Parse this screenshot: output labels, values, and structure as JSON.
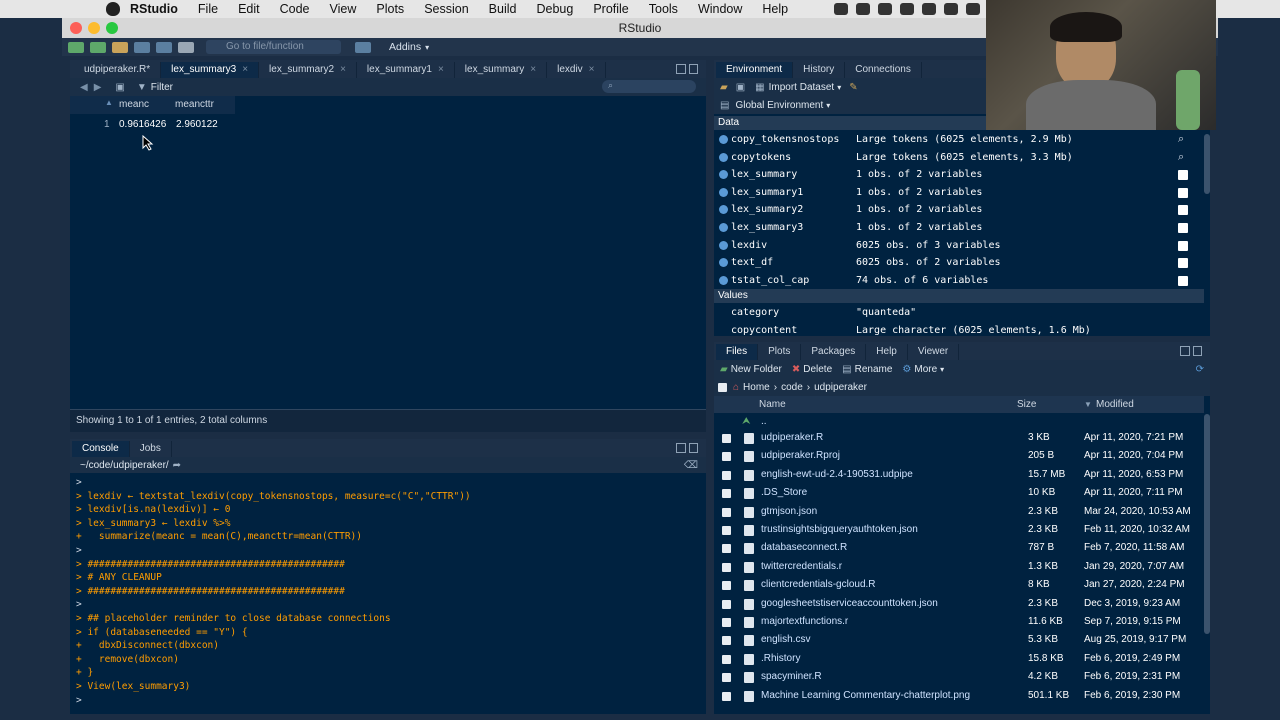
{
  "menubar": {
    "app": "RStudio",
    "items": [
      "File",
      "Edit",
      "Code",
      "View",
      "Plots",
      "Session",
      "Build",
      "Debug",
      "Profile",
      "Tools",
      "Window",
      "Help"
    ]
  },
  "window": {
    "title": "RStudio"
  },
  "toolbar": {
    "goto_placeholder": "Go to file/function",
    "addins": "Addins"
  },
  "editor": {
    "tabs": [
      {
        "label": "udpiperaker.R*"
      },
      {
        "label": "lex_summary3"
      },
      {
        "label": "lex_summary2"
      },
      {
        "label": "lex_summary1"
      },
      {
        "label": "lex_summary"
      },
      {
        "label": "lexdiv"
      }
    ],
    "filter_label": "Filter",
    "columns": [
      "meanc",
      "meancttr"
    ],
    "rows": [
      {
        "index": "1",
        "meanc": "0.9616426",
        "meancttr": "2.960122"
      }
    ],
    "footer": "Showing 1 to 1 of 1 entries, 2 total columns"
  },
  "console": {
    "tabs": [
      "Console",
      "Jobs"
    ],
    "path": "~/code/udpiperaker/",
    "lines": [
      {
        "t": ">",
        "kind": "prompt"
      },
      {
        "t": "> lexdiv ← textstat_lexdiv(copy_tokensnostops, measure=c(\"C\",\"CTTR\"))",
        "kind": "code"
      },
      {
        "t": "> lexdiv[is.na(lexdiv)] ← 0",
        "kind": "code"
      },
      {
        "t": "> lex_summary3 ← lexdiv %>%",
        "kind": "code"
      },
      {
        "t": "+   summarize(meanc = mean(C),meancttr=mean(CTTR))",
        "kind": "code"
      },
      {
        "t": ">",
        "kind": "prompt"
      },
      {
        "t": "> #############################################",
        "kind": "code"
      },
      {
        "t": "> # ANY CLEANUP",
        "kind": "code"
      },
      {
        "t": "> #############################################",
        "kind": "code"
      },
      {
        "t": ">",
        "kind": "prompt"
      },
      {
        "t": "> ## placeholder reminder to close database connections",
        "kind": "code"
      },
      {
        "t": "> if (databaseneeded == \"Y\") {",
        "kind": "code"
      },
      {
        "t": "+   dbxDisconnect(dbxcon)",
        "kind": "code"
      },
      {
        "t": "+   remove(dbxcon)",
        "kind": "code"
      },
      {
        "t": "+ }",
        "kind": "code"
      },
      {
        "t": "> View(lex_summary3)",
        "kind": "code"
      },
      {
        "t": ">",
        "kind": "prompt"
      }
    ]
  },
  "environment": {
    "tabs": [
      "Environment",
      "History",
      "Connections"
    ],
    "import_label": "Import Dataset",
    "scope": "Global Environment",
    "data_header": "Data",
    "values_header": "Values",
    "data": [
      {
        "name": "copy_tokensnostops",
        "value": "Large tokens (6025 elements, 2.9 Mb)",
        "icon": "search-icon"
      },
      {
        "name": "copytokens",
        "value": "Large tokens (6025 elements, 3.3 Mb)",
        "icon": "search-icon"
      },
      {
        "name": "lex_summary",
        "value": "1 obs. of 2 variables",
        "icon": "table-icon"
      },
      {
        "name": "lex_summary1",
        "value": "1 obs. of 2 variables",
        "icon": "table-icon"
      },
      {
        "name": "lex_summary2",
        "value": "1 obs. of 2 variables",
        "icon": "table-icon"
      },
      {
        "name": "lex_summary3",
        "value": "1 obs. of 2 variables",
        "icon": "table-icon"
      },
      {
        "name": "lexdiv",
        "value": "6025 obs. of 3 variables",
        "icon": "table-icon"
      },
      {
        "name": "text_df",
        "value": "6025 obs. of 2 variables",
        "icon": "table-icon"
      },
      {
        "name": "tstat_col_cap",
        "value": "74 obs. of 6 variables",
        "icon": "table-icon"
      }
    ],
    "values": [
      {
        "name": "category",
        "value": "\"quanteda\""
      },
      {
        "name": "copycontent",
        "value": "Large character (6025 elements, 1.6 Mb)"
      }
    ]
  },
  "files": {
    "tabs": [
      "Files",
      "Plots",
      "Packages",
      "Help",
      "Viewer"
    ],
    "actions": {
      "new_folder": "New Folder",
      "delete": "Delete",
      "rename": "Rename",
      "more": "More"
    },
    "breadcrumb": [
      "Home",
      "code",
      "udpiperaker"
    ],
    "columns": {
      "name": "Name",
      "size": "Size",
      "modified": "Modified"
    },
    "up": "..",
    "rows": [
      {
        "name": "udpiperaker.R",
        "size": "3 KB",
        "modified": "Apr 11, 2020, 7:21 PM"
      },
      {
        "name": "udpiperaker.Rproj",
        "size": "205 B",
        "modified": "Apr 11, 2020, 7:04 PM"
      },
      {
        "name": "english-ewt-ud-2.4-190531.udpipe",
        "size": "15.7 MB",
        "modified": "Apr 11, 2020, 6:53 PM"
      },
      {
        "name": ".DS_Store",
        "size": "10 KB",
        "modified": "Apr 11, 2020, 7:11 PM"
      },
      {
        "name": "gtmjson.json",
        "size": "2.3 KB",
        "modified": "Mar 24, 2020, 10:53 AM"
      },
      {
        "name": "trustinsightsbigqueryauthtoken.json",
        "size": "2.3 KB",
        "modified": "Feb 11, 2020, 10:32 AM"
      },
      {
        "name": "databaseconnect.R",
        "size": "787 B",
        "modified": "Feb 7, 2020, 11:58 AM"
      },
      {
        "name": "twittercredentials.r",
        "size": "1.3 KB",
        "modified": "Jan 29, 2020, 7:07 AM"
      },
      {
        "name": "clientcredentials-gcloud.R",
        "size": "8 KB",
        "modified": "Jan 27, 2020, 2:24 PM"
      },
      {
        "name": "googlesheetstiserviceaccounttoken.json",
        "size": "2.3 KB",
        "modified": "Dec 3, 2019, 9:23 AM"
      },
      {
        "name": "majortextfunctions.r",
        "size": "11.6 KB",
        "modified": "Sep 7, 2019, 9:15 PM"
      },
      {
        "name": "english.csv",
        "size": "5.3 KB",
        "modified": "Aug 25, 2019, 9:17 PM"
      },
      {
        "name": ".Rhistory",
        "size": "15.8 KB",
        "modified": "Feb 6, 2019, 2:49 PM"
      },
      {
        "name": "spacyminer.R",
        "size": "4.2 KB",
        "modified": "Feb 6, 2019, 2:31 PM"
      },
      {
        "name": "Machine Learning Commentary-chatterplot.png",
        "size": "501.1 KB",
        "modified": "Feb 6, 2019, 2:30 PM"
      }
    ]
  }
}
